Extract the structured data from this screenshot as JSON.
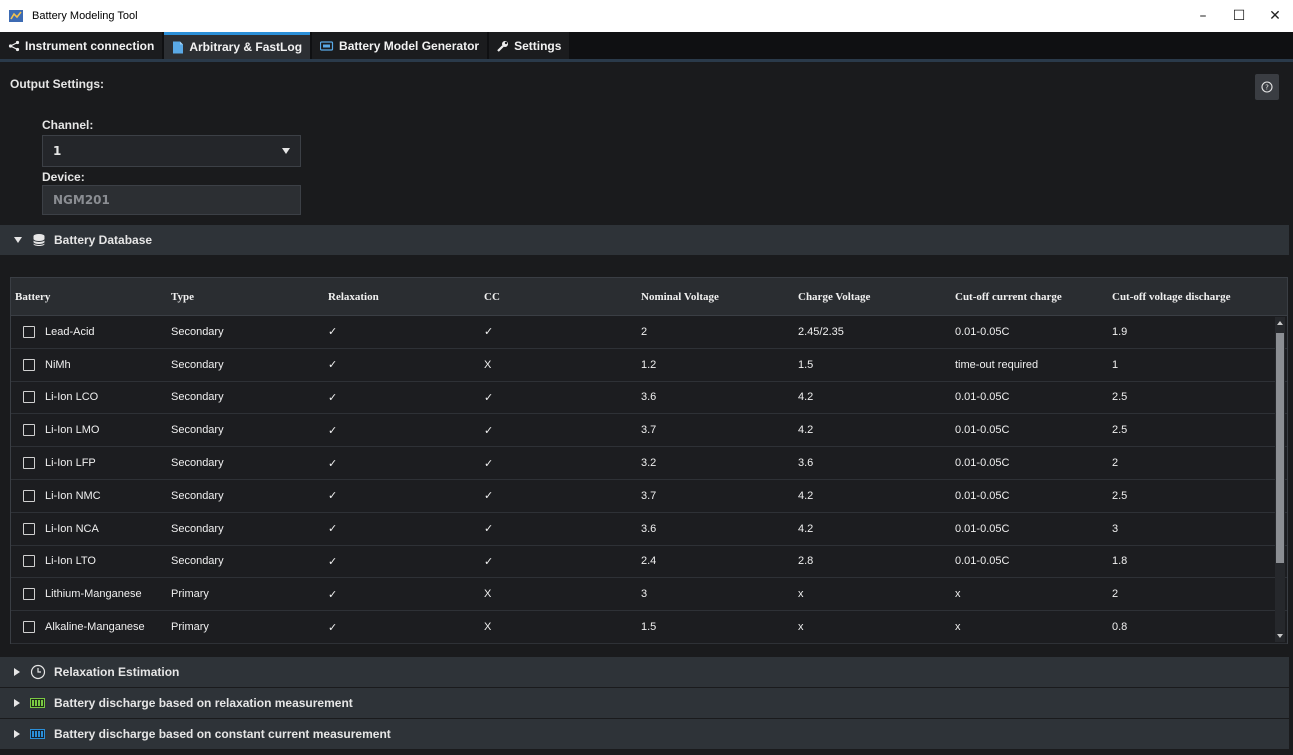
{
  "window": {
    "title": "Battery Modeling Tool",
    "controls": {
      "minimize": "–",
      "maximize": "☐",
      "close": "✕"
    }
  },
  "tabs": [
    {
      "label": "Instrument connection",
      "icon": "share-icon",
      "active": false
    },
    {
      "label": "Arbitrary & FastLog",
      "icon": "document-icon",
      "active": true
    },
    {
      "label": "Battery Model Generator",
      "icon": "battery-outline-icon",
      "active": false
    },
    {
      "label": "Settings",
      "icon": "wrench-icon",
      "active": false
    }
  ],
  "output": {
    "title": "Output Settings:",
    "channel_label": "Channel:",
    "channel_value": "1",
    "device_label": "Device:",
    "device_value": "NGM201"
  },
  "sections": {
    "database": "Battery Database",
    "relaxation": "Relaxation Estimation",
    "discharge_relax": "Battery discharge based on relaxation measurement",
    "discharge_cc": "Battery discharge based on constant current measurement"
  },
  "table": {
    "headers": [
      "Battery",
      "Type",
      "Relaxation",
      "CC",
      "Nominal Voltage",
      "Charge Voltage",
      "Cut-off current charge",
      "Cut-off voltage discharge"
    ],
    "rows": [
      [
        "Lead-Acid",
        "Secondary",
        "✓",
        "✓",
        "2",
        "2.45/2.35",
        "0.01-0.05C",
        "1.9"
      ],
      [
        "NiMh",
        "Secondary",
        "✓",
        "X",
        "1.2",
        "1.5",
        "time-out required",
        "1"
      ],
      [
        "Li-Ion LCO",
        "Secondary",
        "✓",
        "✓",
        "3.6",
        "4.2",
        "0.01-0.05C",
        "2.5"
      ],
      [
        "Li-Ion LMO",
        "Secondary",
        "✓",
        "✓",
        "3.7",
        "4.2",
        "0.01-0.05C",
        "2.5"
      ],
      [
        "Li-Ion LFP",
        "Secondary",
        "✓",
        "✓",
        "3.2",
        "3.6",
        "0.01-0.05C",
        "2"
      ],
      [
        "Li-Ion NMC",
        "Secondary",
        "✓",
        "✓",
        "3.7",
        "4.2",
        "0.01-0.05C",
        "2.5"
      ],
      [
        "Li-Ion NCA",
        "Secondary",
        "✓",
        "✓",
        "3.6",
        "4.2",
        "0.01-0.05C",
        "3"
      ],
      [
        "Li-Ion LTO",
        "Secondary",
        "✓",
        "✓",
        "2.4",
        "2.8",
        "0.01-0.05C",
        "1.8"
      ],
      [
        "Lithium-Manganese",
        "Primary",
        "✓",
        "X",
        "3",
        "x",
        "x",
        "2"
      ],
      [
        "Alkaline-Manganese",
        "Primary",
        "✓",
        "X",
        "1.5",
        "x",
        "x",
        "0.8"
      ]
    ]
  },
  "colors": {
    "accent": "#2b8fd8",
    "background": "#1a1b1d",
    "section": "#2e3338",
    "battery_green": "#7ac943",
    "battery_blue": "#2b8fd8"
  }
}
